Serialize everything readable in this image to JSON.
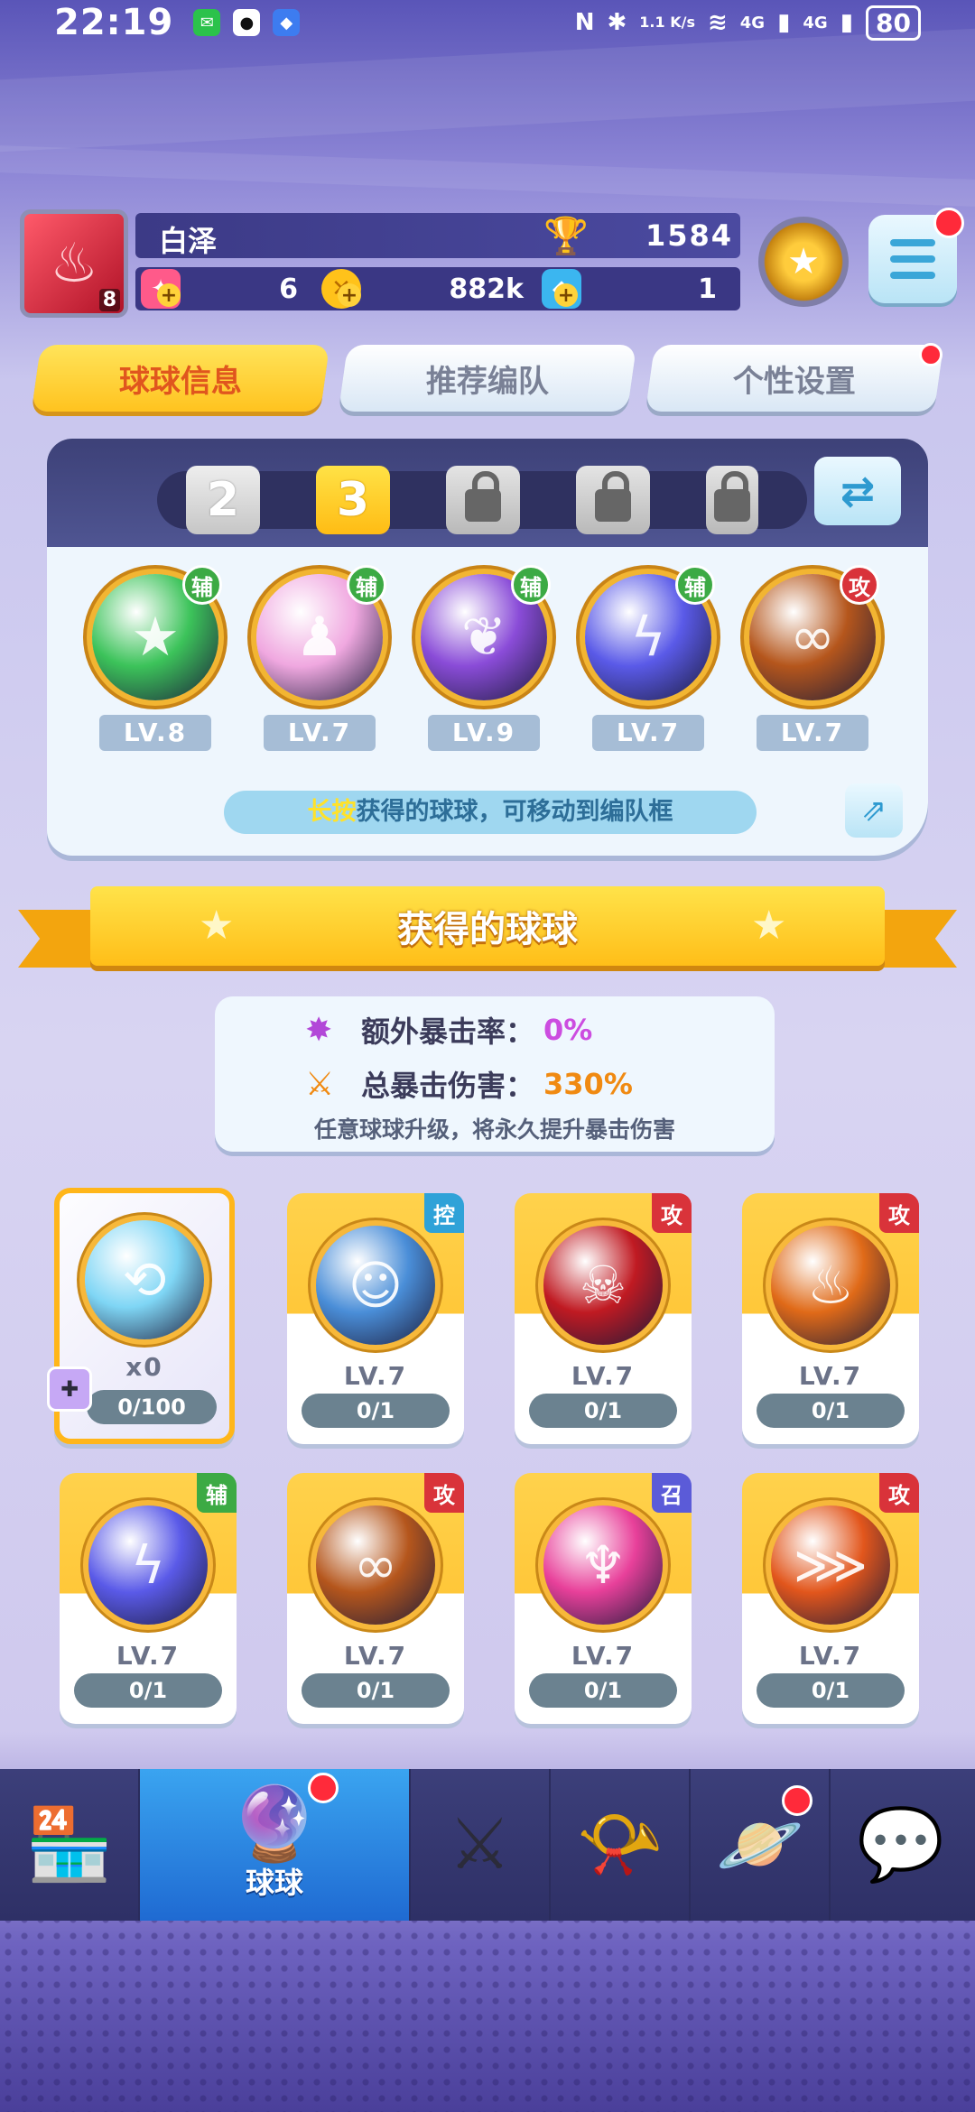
{
  "status_bar": {
    "time": "22:19",
    "net_speed": "1.1\nK/s",
    "net_speed_display": "1.1 K/s",
    "signal1": "4G",
    "signal2": "4G",
    "battery": "80"
  },
  "player": {
    "name": "白泽",
    "avatar_level": "8",
    "trophy_score": "1584",
    "resources": {
      "tickets": "6",
      "coins": "882k",
      "gems": "1"
    }
  },
  "tabs": [
    {
      "label": "球球信息",
      "active": true
    },
    {
      "label": "推荐编队",
      "active": false
    },
    {
      "label": "个性设置",
      "active": false,
      "has_red_dot": true
    }
  ],
  "team": {
    "slots": [
      {
        "label": "2",
        "state": "unlocked"
      },
      {
        "label": "3",
        "state": "selected"
      },
      {
        "label": "",
        "state": "locked"
      },
      {
        "label": "",
        "state": "locked"
      },
      {
        "label": "",
        "state": "locked"
      }
    ],
    "equipped": [
      {
        "icon": "green-star-ball",
        "tag": "辅",
        "tag_type": "fu",
        "level": "LV.8",
        "color": "#3cc35a"
      },
      {
        "icon": "rainbow-figures-ball",
        "tag": "辅",
        "tag_type": "fu",
        "level": "LV.7",
        "color": "#f0a8e0"
      },
      {
        "icon": "purple-leaf-ball",
        "tag": "辅",
        "tag_type": "fu",
        "level": "LV.9",
        "color": "#8a4cd8"
      },
      {
        "icon": "lightning-ball",
        "tag": "辅",
        "tag_type": "fu",
        "level": "LV.7",
        "color": "#5a5ae8"
      },
      {
        "icon": "infinity-ball",
        "tag": "攻",
        "tag_type": "gong",
        "level": "LV.7",
        "color": "#b5561c"
      }
    ],
    "hint_highlight": "长按",
    "hint_rest": "获得的球球，可移动到编队框"
  },
  "banner": {
    "title": "获得的球球"
  },
  "crit": {
    "extra_rate_label": "额外暴击率：",
    "extra_rate_value": "0%",
    "total_damage_label": "总暴击伤害：",
    "total_damage_value": "330%",
    "note": "任意球球升级，将永久提升暴击伤害"
  },
  "owned_balls": [
    {
      "icon": "rainbow-swirl-ball",
      "tag": "",
      "tag_type": "",
      "level": "x0",
      "progress": "0/100",
      "color": "#7fd6f5",
      "special": true
    },
    {
      "icon": "wizard-ball",
      "tag": "控",
      "tag_type": "kong",
      "level": "LV.7",
      "progress": "0/1",
      "color": "#4a8ed8"
    },
    {
      "icon": "venom-ball",
      "tag": "攻",
      "tag_type": "gong",
      "level": "LV.7",
      "progress": "0/1",
      "color": "#c01a22"
    },
    {
      "icon": "fire-spirit-ball",
      "tag": "攻",
      "tag_type": "gong",
      "level": "LV.7",
      "progress": "0/1",
      "color": "#e06a18"
    },
    {
      "icon": "lightning-ball",
      "tag": "辅",
      "tag_type": "fu",
      "level": "LV.7",
      "progress": "0/1",
      "color": "#5a5ae8"
    },
    {
      "icon": "infinity-ball",
      "tag": "攻",
      "tag_type": "gong",
      "level": "LV.7",
      "progress": "0/1",
      "color": "#b5561c"
    },
    {
      "icon": "phoenix-ball",
      "tag": "召",
      "tag_type": "zhao",
      "level": "LV.7",
      "progress": "0/1",
      "color": "#e8409a"
    },
    {
      "icon": "claw-ball",
      "tag": "攻",
      "tag_type": "gong",
      "level": "LV.7",
      "progress": "0/1",
      "color": "#e2561c"
    }
  ],
  "bottom_nav": [
    {
      "icon": "shop-icon",
      "label": "",
      "active": false
    },
    {
      "icon": "ball-icon",
      "label": "球球",
      "active": true,
      "has_red_dot": true
    },
    {
      "icon": "crossed-swords-icon",
      "label": "",
      "active": false
    },
    {
      "icon": "whistle-icon",
      "label": "",
      "active": false
    },
    {
      "icon": "planet-icon",
      "label": "",
      "active": false,
      "has_red_dot": true
    },
    {
      "icon": "chat-heart-icon",
      "label": "",
      "active": false
    }
  ]
}
